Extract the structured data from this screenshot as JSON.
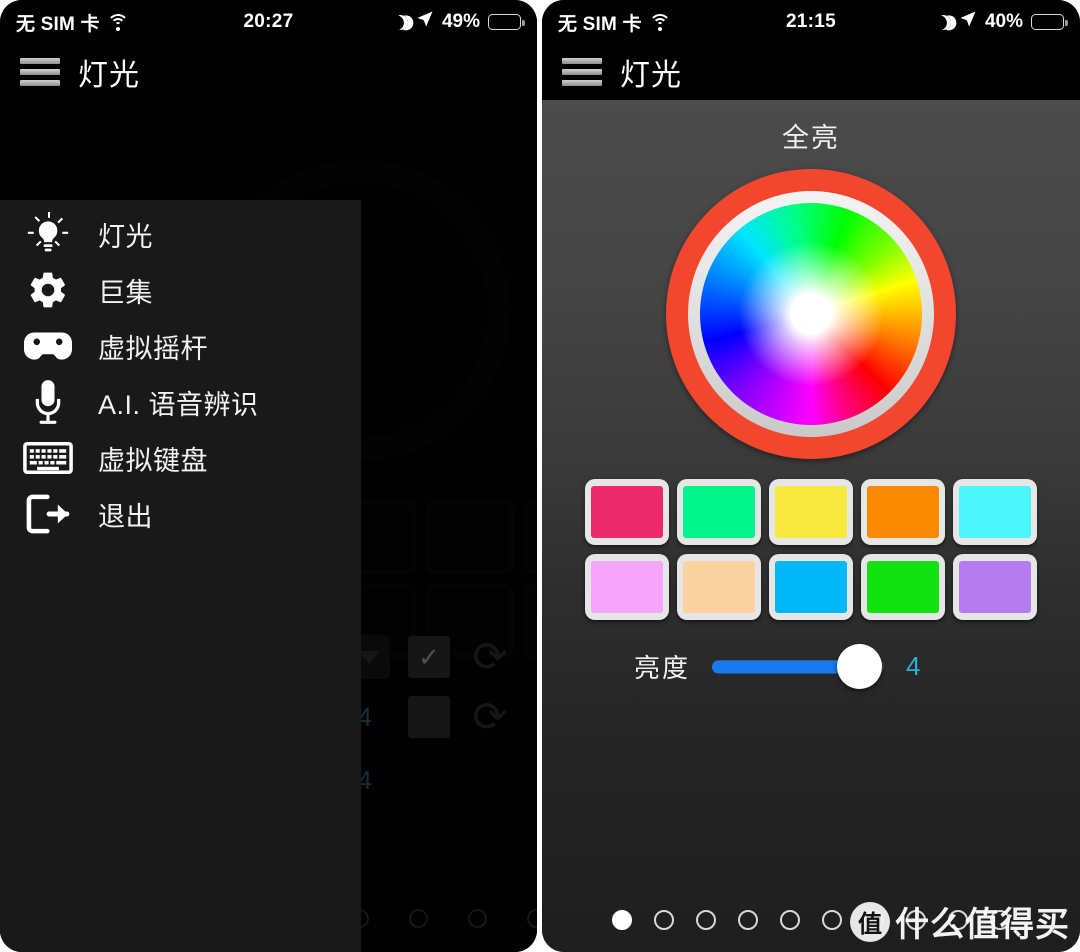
{
  "left_phone": {
    "status_bar": {
      "carrier": "无 SIM 卡",
      "wifi_icon": "wifi-icon",
      "time": "20:27",
      "moon_icon": "moon-icon",
      "location_icon": "location-arrow-icon",
      "battery_percent": "49%",
      "battery_level": 49
    },
    "app_bar": {
      "menu_icon": "hamburger-menu-icon",
      "title": "灯光"
    },
    "drawer": {
      "items": [
        {
          "label": "灯光",
          "icon": "light-bulb-icon"
        },
        {
          "label": "巨集",
          "icon": "gear-icon"
        },
        {
          "label": "虚拟摇杆",
          "icon": "gamepad-icon"
        },
        {
          "label": "A.I. 语音辨识",
          "icon": "microphone-icon"
        },
        {
          "label": "虚拟键盘",
          "icon": "keyboard-icon"
        },
        {
          "label": "退出",
          "icon": "exit-icon"
        }
      ]
    },
    "background_content": {
      "value_1": "4",
      "value_2": "4",
      "refresh_icon": "refresh-icon",
      "checkbox_checked_icon": "checkbox-checked-icon",
      "checkbox_unchecked_icon": "checkbox-unchecked-icon",
      "dropdown_caret_icon": "caret-down-icon",
      "pager_dots": 4
    }
  },
  "right_phone": {
    "status_bar": {
      "carrier": "无 SIM 卡",
      "wifi_icon": "wifi-icon",
      "time": "21:15",
      "moon_icon": "moon-icon",
      "location_icon": "location-arrow-icon",
      "battery_percent": "40%",
      "battery_level": 40
    },
    "app_bar": {
      "menu_icon": "hamburger-menu-icon",
      "title": "灯光"
    },
    "preset_title": "全亮",
    "color_wheel": {
      "outer_ring_color": "#f2472e",
      "mid_ring_color": "#dcdcdc",
      "selected_color": "#ffffff",
      "knob_position": "center"
    },
    "swatches": [
      {
        "name": "swatch-crimson-pink",
        "color": "#ed2a6b"
      },
      {
        "name": "swatch-spring-green",
        "color": "#00f58c"
      },
      {
        "name": "swatch-yellow",
        "color": "#f7e93f"
      },
      {
        "name": "swatch-orange",
        "color": "#fc8a00"
      },
      {
        "name": "swatch-cyan",
        "color": "#4cf4fb"
      },
      {
        "name": "swatch-light-violet",
        "color": "#f5a5fb"
      },
      {
        "name": "swatch-peach",
        "color": "#fbd3a0"
      },
      {
        "name": "swatch-sky-blue",
        "color": "#00b8f7"
      },
      {
        "name": "swatch-green",
        "color": "#12e212"
      },
      {
        "name": "swatch-purple",
        "color": "#b57cf0"
      }
    ],
    "brightness": {
      "label": "亮度",
      "value": "4",
      "fill_percent": 86,
      "track_color": "#4a4a4a",
      "fill_color": "#1579ef",
      "value_color": "#28b0d8"
    },
    "pager": {
      "total": 10,
      "active_index": 0
    },
    "watermark": {
      "badge": "值",
      "text": "什么值得买"
    }
  }
}
